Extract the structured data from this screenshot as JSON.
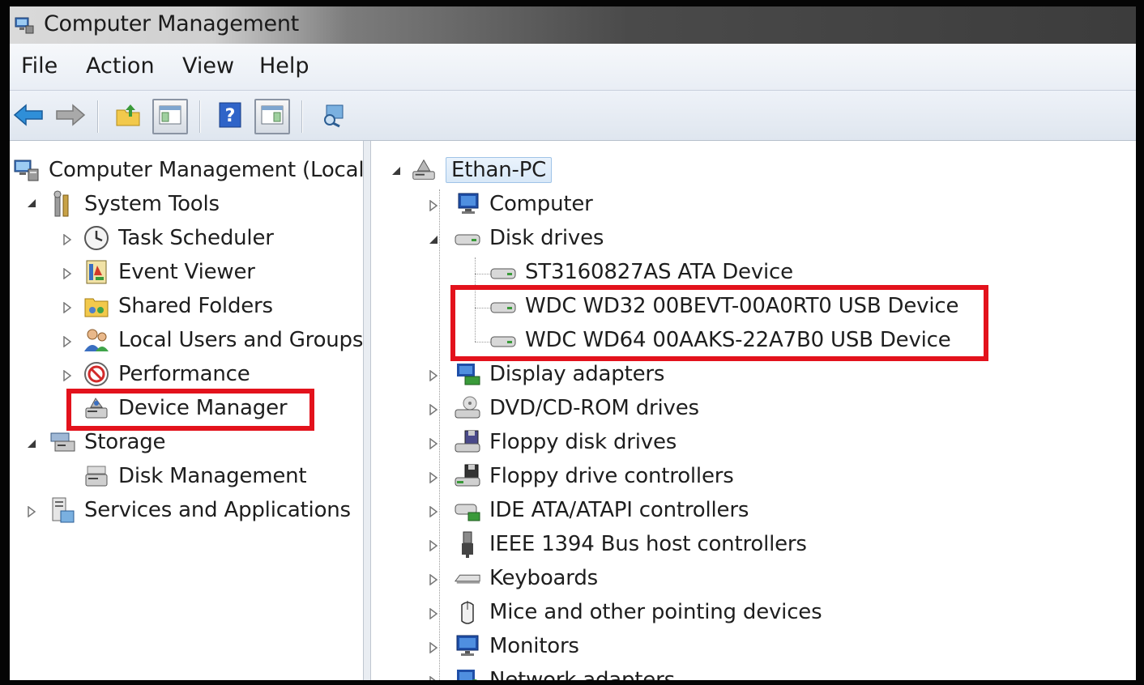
{
  "window": {
    "title": "Computer Management"
  },
  "menu": [
    "File",
    "Action",
    "View",
    "Help"
  ],
  "toolbar": {
    "buttons": [
      "back-icon",
      "forward-icon",
      "up-folder-icon",
      "show-hide-tree-icon",
      "help-icon",
      "action-pane-icon",
      "properties-icon"
    ]
  },
  "left_tree": {
    "root": "Computer Management (Local",
    "system_tools": "System Tools",
    "items": [
      "Task Scheduler",
      "Event Viewer",
      "Shared Folders",
      "Local Users and Groups",
      "Performance",
      "Device Manager"
    ],
    "storage": "Storage",
    "disk_management": "Disk Management",
    "services": "Services and Applications"
  },
  "right_tree": {
    "root": "Ethan-PC",
    "computer": "Computer",
    "disk_drives": "Disk drives",
    "disks": [
      "ST3160827AS ATA Device",
      "WDC WD32 00BEVT-00A0RT0 USB Device",
      "WDC WD64 00AAKS-22A7B0 USB Device"
    ],
    "categories": [
      "Display adapters",
      "DVD/CD-ROM drives",
      "Floppy disk drives",
      "Floppy drive controllers",
      "IDE ATA/ATAPI controllers",
      "IEEE 1394 Bus host controllers",
      "Keyboards",
      "Mice and other pointing devices",
      "Monitors",
      "Network adapters"
    ]
  },
  "colors": {
    "highlight": "#e3121c"
  }
}
